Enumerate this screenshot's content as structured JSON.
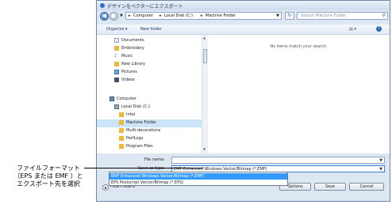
{
  "window": {
    "title": "デザインをベクターにエクスポート"
  },
  "address": {
    "crumbs": [
      "Computer",
      "Local Disk (C:)",
      "Machine Folder"
    ]
  },
  "search": {
    "placeholder": "Search Machine Folder"
  },
  "toolbar": {
    "organize": "Organize ▾",
    "new_folder": "New folder"
  },
  "nav": {
    "items": [
      {
        "label": "Documents",
        "icon": "documents-icon"
      },
      {
        "label": "Embroidery",
        "icon": "folder-icon"
      },
      {
        "label": "Music",
        "icon": "music-icon"
      },
      {
        "label": "New Library",
        "icon": "library-icon"
      },
      {
        "label": "Pictures",
        "icon": "pictures-icon"
      },
      {
        "label": "Videos",
        "icon": "videos-icon"
      },
      {
        "label": "Computer",
        "icon": "computer-icon"
      },
      {
        "label": "Local Disk (C:)",
        "icon": "drive-icon"
      },
      {
        "label": "Intel",
        "icon": "folder-icon"
      },
      {
        "label": "Machine Folder",
        "icon": "folder-icon"
      },
      {
        "label": "Multi-decorations",
        "icon": "folder-icon"
      },
      {
        "label": "PerfLogs",
        "icon": "folder-icon"
      },
      {
        "label": "Program Files",
        "icon": "folder-icon"
      }
    ]
  },
  "filepane": {
    "empty_text": "No items match your search."
  },
  "form": {
    "file_name_label": "File name:",
    "file_name_value": "",
    "save_type_label": "Save as type:",
    "save_type_value": "EMF Enhanced Windows Vector/Bitmap (*.EMF)",
    "options": [
      "EMF Enhanced Windows Vector/Bitmap (*.EMF)",
      "EPS Postscript Vector/Bitmap (*.EPS)"
    ]
  },
  "footer": {
    "hide_folders": "Hide Folders",
    "options": "Options",
    "save": "Save",
    "cancel": "Cancel"
  },
  "annotation": {
    "line1": "ファイルフォーマット",
    "line2": "（EPS または EMF ）と",
    "line3": "エクスポート先を選択"
  },
  "colors": {
    "accent": "#3399ff",
    "window_bg": "#dde7f2"
  }
}
